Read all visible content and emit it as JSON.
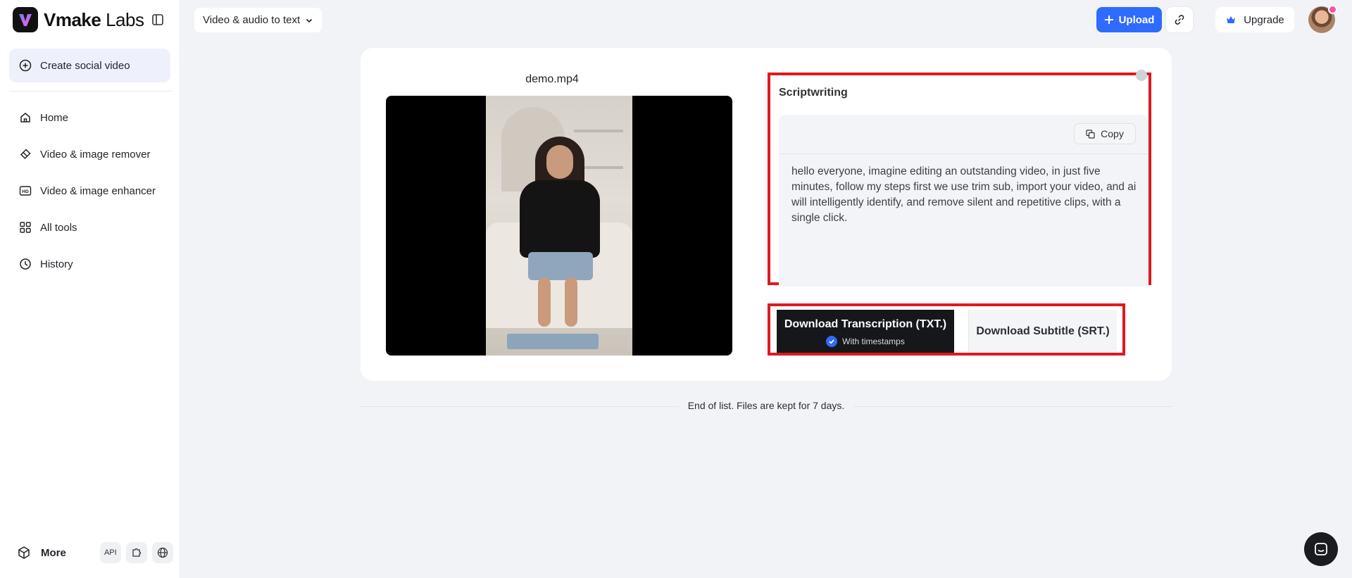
{
  "app": {
    "logo_bold": "Vmake",
    "logo_light": " Labs"
  },
  "sidebar": {
    "create_label": "Create social video",
    "items": [
      {
        "label": "Home",
        "icon": "home-icon"
      },
      {
        "label": "Video & image remover",
        "icon": "eraser-icon"
      },
      {
        "label": "Video & image enhancer",
        "icon": "hd-icon"
      },
      {
        "label": "All tools",
        "icon": "grid-icon"
      },
      {
        "label": "History",
        "icon": "clock-icon"
      }
    ],
    "more_label": "More",
    "api_label": "API"
  },
  "header": {
    "tool_select": "Video & audio to text",
    "upload_label": "Upload",
    "upgrade_label": "Upgrade"
  },
  "main": {
    "filename": "demo.mp4",
    "script_title": "Scriptwriting",
    "copy_label": "Copy",
    "script_text": "hello everyone, imagine editing an outstanding video, in just five minutes, follow my steps first we use trim sub, import your video, and ai will intelligently identify, and remove silent and repetitive clips, with a single click.",
    "download_txt_label": "Download Transcription (TXT.)",
    "download_txt_sub": "With timestamps",
    "download_srt_label": "Download Subtitle (SRT.)",
    "end_text": "End of list. Files are kept for 7 days."
  },
  "colors": {
    "accent": "#2f6bff",
    "highlight": "#e0191f",
    "dark_button": "#16171a"
  }
}
